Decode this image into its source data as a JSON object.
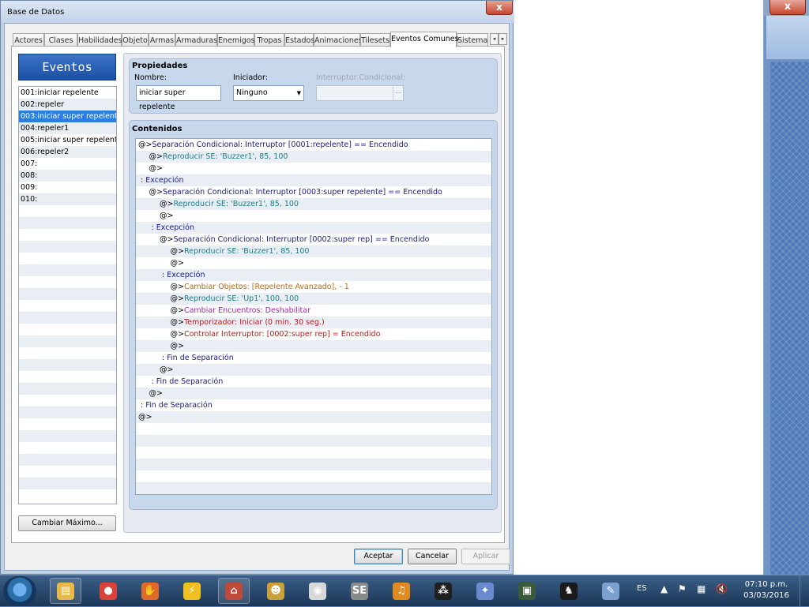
{
  "dialog": {
    "title": "Base de Datos",
    "close_label": "x",
    "tabs": [
      "Actores",
      "Clases",
      "Habilidades",
      "Objeto",
      "Armas",
      "Armaduras",
      "Enemigos",
      "Tropas",
      "Estados",
      "Animaciones",
      "Tilesets",
      "Eventos Comunes",
      "Sistema"
    ],
    "active_tab": "Eventos Comunes",
    "tab_scroll_left": "◂",
    "tab_scroll_right": "▸"
  },
  "events": {
    "header": "Eventos Comunes",
    "items": [
      "001:iniciar repelente",
      "002:repeler",
      "003:iniciar super repelente",
      "004:repeler1",
      "005:iniciar super repelente",
      "006:repeler2",
      "007:",
      "008:",
      "009:",
      "010:"
    ],
    "selected_index": 2,
    "change_max_label": "Cambiar Máximo..."
  },
  "properties": {
    "title": "Propiedades",
    "name_label": "Nombre:",
    "name_value": "iniciar super repelente",
    "trigger_label": "Iniciador:",
    "trigger_value": "Ninguno",
    "switch_label": "Interruptor Condicional:",
    "switch_button": "..."
  },
  "contents": {
    "title": "Contenidos",
    "lines": [
      {
        "indent": 0,
        "prefix": "@>",
        "text": "Separación Condicional: Interruptor [0001:repelente] == Encendido",
        "color": "blue"
      },
      {
        "indent": 1,
        "prefix": "@>",
        "text": "Reproducir SE: 'Buzzer1', 85, 100",
        "color": "teal"
      },
      {
        "indent": 1,
        "prefix": "@>",
        "text": "",
        "color": "blue"
      },
      {
        "indent": 0,
        "prefix": " : ",
        "text": "Excepción",
        "color": "blue"
      },
      {
        "indent": 1,
        "prefix": "@>",
        "text": "Separación Condicional: Interruptor [0003:super repelente] == Encendido",
        "color": "blue"
      },
      {
        "indent": 2,
        "prefix": "@>",
        "text": "Reproducir SE: 'Buzzer1', 85, 100",
        "color": "teal"
      },
      {
        "indent": 2,
        "prefix": "@>",
        "text": "",
        "color": "blue"
      },
      {
        "indent": 1,
        "prefix": " : ",
        "text": "Excepción",
        "color": "blue"
      },
      {
        "indent": 2,
        "prefix": "@>",
        "text": "Separación Condicional: Interruptor [0002:super rep] == Encendido",
        "color": "blue"
      },
      {
        "indent": 3,
        "prefix": "@>",
        "text": "Reproducir SE: 'Buzzer1', 85, 100",
        "color": "teal"
      },
      {
        "indent": 3,
        "prefix": "@>",
        "text": "",
        "color": "blue"
      },
      {
        "indent": 2,
        "prefix": " : ",
        "text": "Excepción",
        "color": "blue"
      },
      {
        "indent": 3,
        "prefix": "@>",
        "text": "Cambiar Objetos: [Repelente Avanzado], - 1",
        "color": "orange"
      },
      {
        "indent": 3,
        "prefix": "@>",
        "text": "Reproducir SE: 'Up1', 100, 100",
        "color": "teal"
      },
      {
        "indent": 3,
        "prefix": "@>",
        "text": "Cambiar Encuentros: Deshabilitar",
        "color": "magenta"
      },
      {
        "indent": 3,
        "prefix": "@>",
        "text": "Temporizador: Iniciar (0 min. 30 seg.)",
        "color": "red"
      },
      {
        "indent": 3,
        "prefix": "@>",
        "text": "Controlar Interruptor: [0002:super rep] = Encendido",
        "color": "red"
      },
      {
        "indent": 3,
        "prefix": "@>",
        "text": "",
        "color": "blue"
      },
      {
        "indent": 2,
        "prefix": " : ",
        "text": "Fin de Separación",
        "color": "blue"
      },
      {
        "indent": 2,
        "prefix": "@>",
        "text": "",
        "color": "blue"
      },
      {
        "indent": 1,
        "prefix": " : ",
        "text": "Fin de Separación",
        "color": "blue"
      },
      {
        "indent": 1,
        "prefix": "@>",
        "text": "",
        "color": "blue"
      },
      {
        "indent": 0,
        "prefix": " : ",
        "text": "Fin de Separación",
        "color": "blue"
      },
      {
        "indent": 0,
        "prefix": "@>",
        "text": "",
        "color": "blue"
      }
    ]
  },
  "buttons": {
    "accept": "Aceptar",
    "cancel": "Cancelar",
    "apply": "Aplicar"
  },
  "taskbar": {
    "apps": [
      {
        "name": "explorer-icon",
        "glyph": "▤",
        "color": "#e8b84a"
      },
      {
        "name": "chrome-icon",
        "glyph": "●",
        "color": "#d9433a"
      },
      {
        "name": "glove-icon",
        "glyph": "✋",
        "color": "#e06a2a"
      },
      {
        "name": "winamp-icon",
        "glyph": "⚡",
        "color": "#f0c020"
      },
      {
        "name": "rpg-maker-icon",
        "glyph": "⌂",
        "color": "#c04a3a"
      },
      {
        "name": "gimp-icon",
        "glyph": "☻",
        "color": "#c9a03a"
      },
      {
        "name": "media-icon",
        "glyph": "◉",
        "color": "#d8d8d8"
      },
      {
        "name": "sound-editor-icon",
        "glyph": "SE",
        "color": "#8a8a8a"
      },
      {
        "name": "audacity-icon",
        "glyph": "♫",
        "color": "#e08a20"
      },
      {
        "name": "blackberry-icon",
        "glyph": "⁂",
        "color": "#202020"
      },
      {
        "name": "network-icon",
        "glyph": "✦",
        "color": "#6a8ad0"
      },
      {
        "name": "terminal-icon",
        "glyph": "▣",
        "color": "#3a5a3a"
      },
      {
        "name": "game-icon",
        "glyph": "♞",
        "color": "#1a1a1a"
      },
      {
        "name": "paint-icon",
        "glyph": "✎",
        "color": "#7aa0d0"
      }
    ],
    "lang": "ES",
    "time": "07:10 p.m.",
    "date": "03/03/2016"
  },
  "colors": {
    "blue": "#1a1a8c",
    "teal": "#1f7a8a",
    "orange": "#c06a12",
    "magenta": "#b020b0",
    "red": "#c01818",
    "selection": "#2a7ee0"
  }
}
